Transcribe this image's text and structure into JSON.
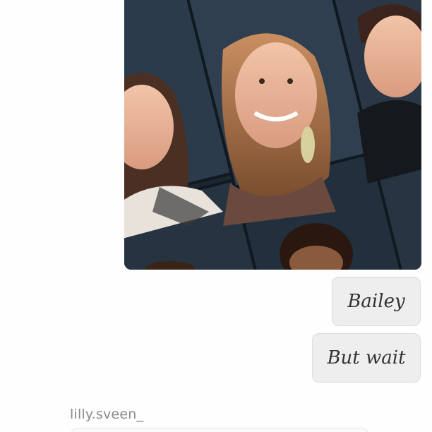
{
  "thread": {
    "photo": {
      "alt_icon": "yearbook-photo-image",
      "colors": {
        "background": "#1e2a36",
        "frame": "#2d3a48"
      }
    },
    "messages": [
      {
        "text": "Bailey"
      },
      {
        "text": "But wait"
      }
    ],
    "next_sender": "lilly.sveen_"
  },
  "colors": {
    "bubble_bg": "#eeeeee",
    "bubble_border": "#dcdcdc",
    "sender_text": "#8a8a8a"
  }
}
